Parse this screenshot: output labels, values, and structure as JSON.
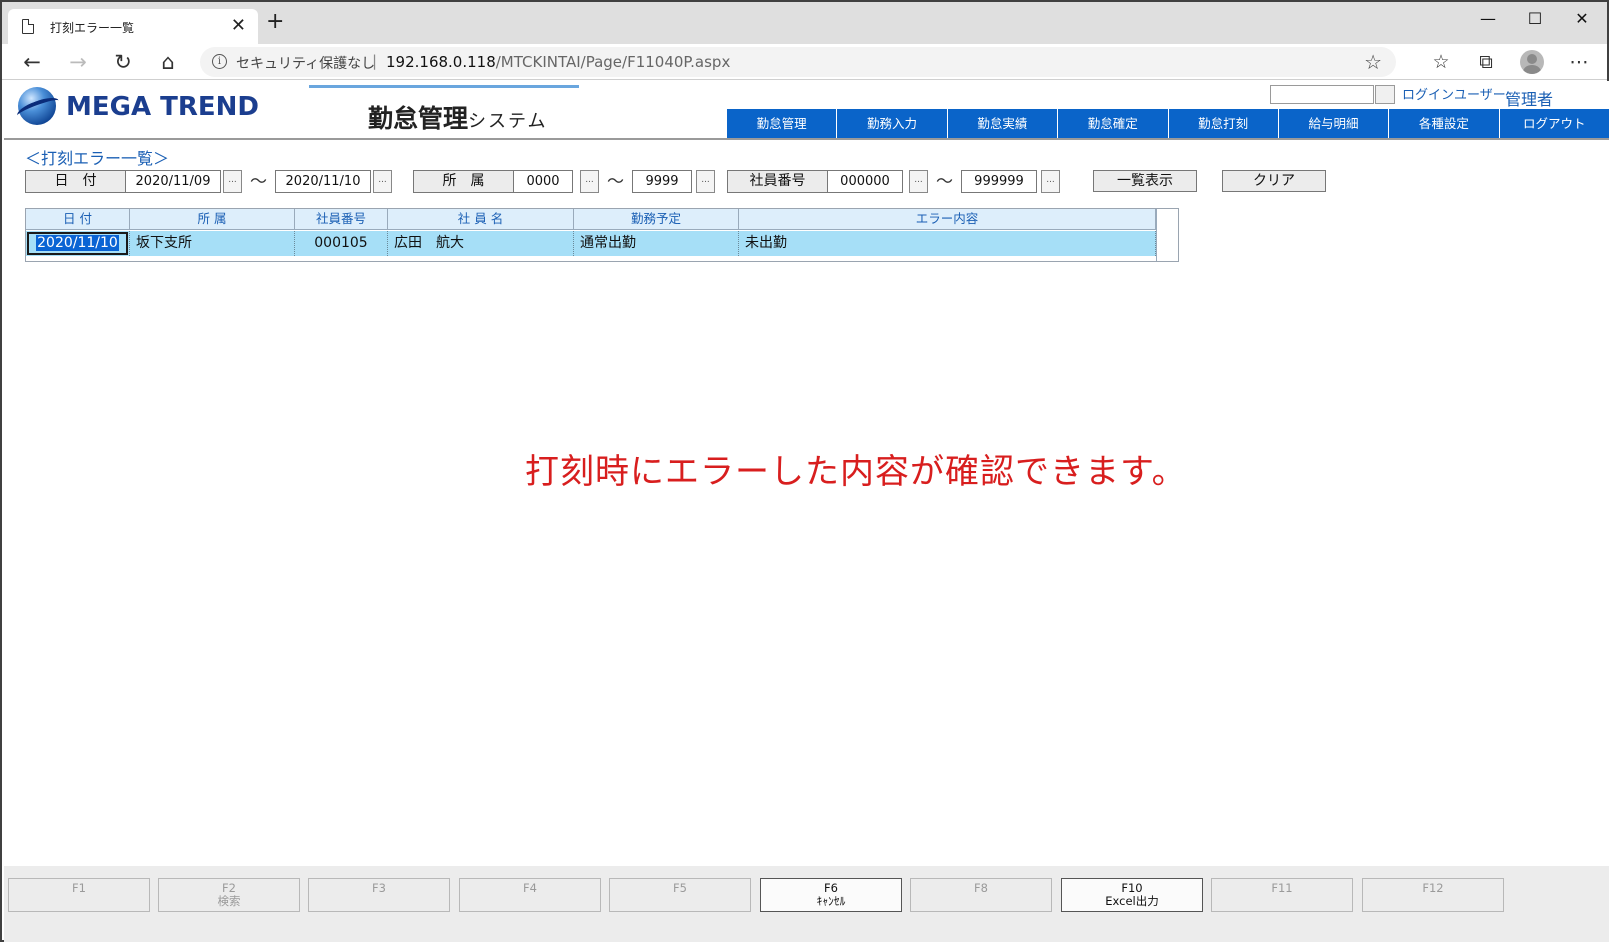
{
  "browser": {
    "tab_title": "打刻エラー一覧",
    "close_glyph": "✕",
    "new_tab_glyph": "+",
    "security_text": "セキュリティ保護なし",
    "url_host": "192.168.0.118",
    "url_path": "/MTCKINTAI/Page/F11040P.aspx",
    "window_controls": [
      "—",
      "☐",
      "✕"
    ]
  },
  "header": {
    "logo_text": "MEGA TREND",
    "system_title": "勤怠管理",
    "system_subtitle": "システム",
    "login_label": "ログインユーザー:",
    "login_user": "管理者",
    "menu": [
      "勤怠管理",
      "勤務入力",
      "勤怠実績",
      "勤怠確定",
      "勤怠打刻",
      "給与明細",
      "各種設定",
      "ログアウト"
    ]
  },
  "page": {
    "heading": "＜打刻エラー一覧＞",
    "notice": "打刻時にエラーした内容が確認できます。"
  },
  "filters": {
    "date_label": "日　付",
    "date_from": "2020/11/09",
    "date_to": "2020/11/10",
    "dept_label": "所　属",
    "dept_from": "0000",
    "dept_to": "9999",
    "emp_label": "社員番号",
    "emp_from": "000000",
    "emp_to": "999999",
    "dots": "...",
    "tilde": "〜",
    "list_button": "一覧表示",
    "clear_button": "クリア"
  },
  "grid": {
    "columns": [
      "日 付",
      "所 属",
      "社員番号",
      "社 員 名",
      "勤務予定",
      "エラー内容"
    ],
    "rows": [
      {
        "date": "2020/11/10",
        "dept": "坂下支所",
        "emp_no": "000105",
        "name": "広田　航大",
        "schedule": "通常出勤",
        "error": "未出勤"
      }
    ]
  },
  "fkeys": [
    {
      "key": "F1",
      "label": "",
      "active": false
    },
    {
      "key": "F2",
      "label": "検索",
      "active": false
    },
    {
      "key": "F3",
      "label": "",
      "active": false
    },
    {
      "key": "F4",
      "label": "",
      "active": false
    },
    {
      "key": "F5",
      "label": "",
      "active": false
    },
    {
      "key": "F6",
      "label": "ｷｬﾝｾﾙ",
      "active": true
    },
    {
      "key": "F8",
      "label": "",
      "active": false
    },
    {
      "key": "F10",
      "label": "Excel出力",
      "active": true
    },
    {
      "key": "F11",
      "label": "",
      "active": false
    },
    {
      "key": "F12",
      "label": "",
      "active": false
    }
  ]
}
